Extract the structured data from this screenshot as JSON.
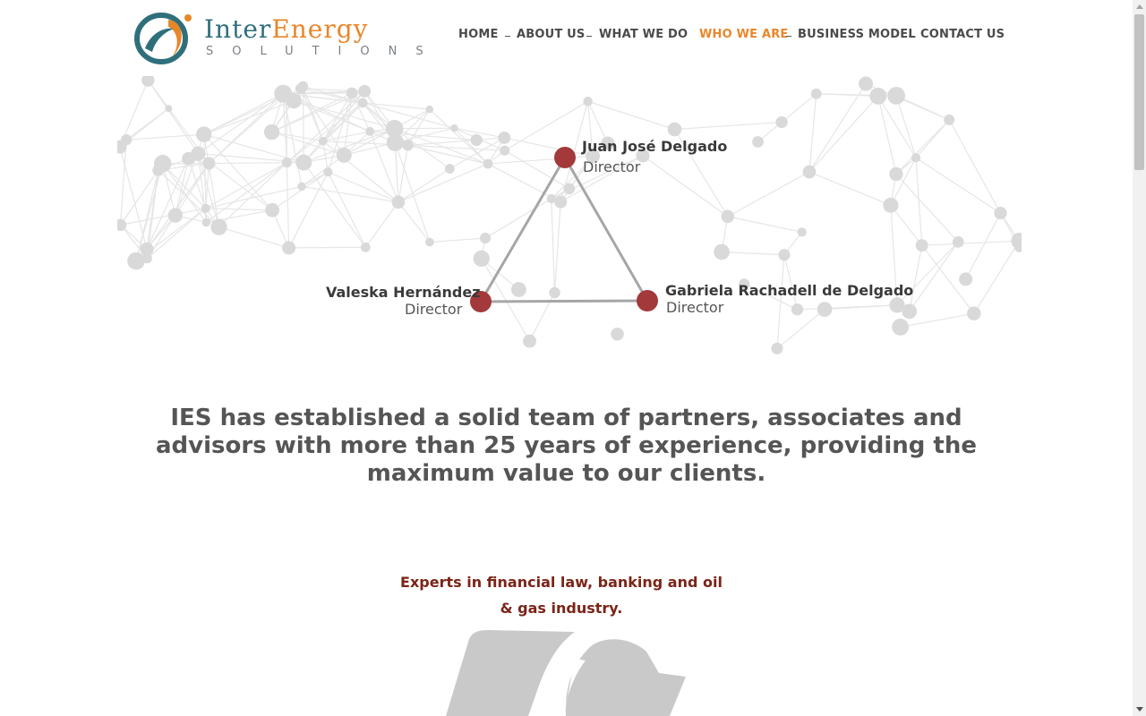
{
  "brand": {
    "name_part1": "Inter",
    "name_part2": "Energy",
    "tagline": "SOLUTIONS",
    "colors": {
      "teal": "#2f6f7c",
      "orange": "#e8872a",
      "gray": "#7a7f85"
    }
  },
  "nav": {
    "items": [
      {
        "label": "HOME",
        "active": false
      },
      {
        "label": "ABOUT US",
        "active": false
      },
      {
        "label": "WHAT WE DO",
        "active": false
      },
      {
        "label": "WHO WE ARE",
        "active": true
      },
      {
        "label": "BUSINESS MODEL",
        "active": false
      },
      {
        "label": "CONTACT US",
        "active": false
      }
    ]
  },
  "team": {
    "top": {
      "name": "Juan José Delgado",
      "role": "Director"
    },
    "left": {
      "name": "Valeska Hernández",
      "role": "Director"
    },
    "right": {
      "name": "Gabriela Rachadell de Delgado",
      "role": "Director"
    },
    "node_color": "#a3393a",
    "network_color": "#d9d9d9"
  },
  "statement": "IES has established a solid team of partners, associates and advisors with more than 25 years of experience, providing the maximum value to our clients.",
  "experts": {
    "line1": "Experts in financial law, banking and oil",
    "line2": "& gas industry."
  },
  "scrollbar": {
    "position": 0.0
  }
}
